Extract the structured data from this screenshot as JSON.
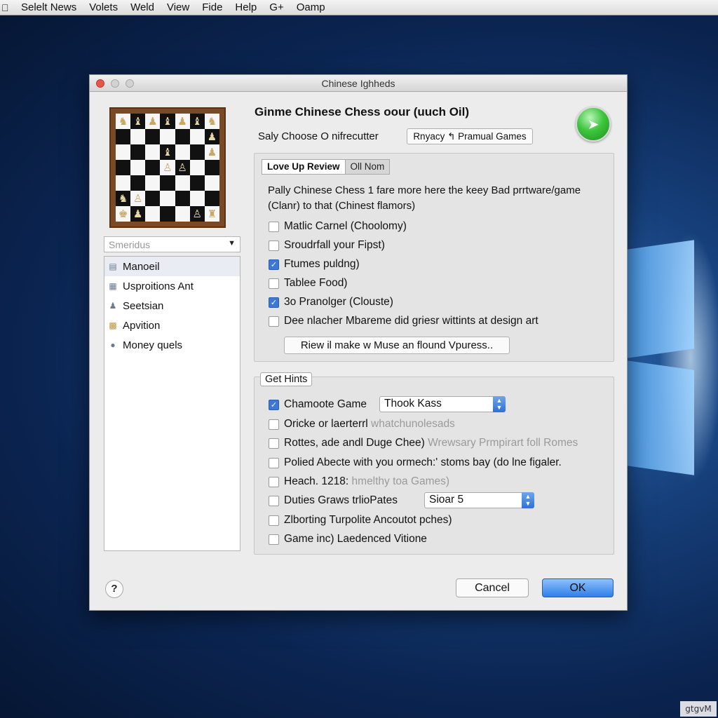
{
  "menubar": {
    "apple_icon": "apple-icon",
    "items": [
      "Selelt News",
      "Volets",
      "Weld",
      "View",
      "Fide",
      "Help",
      "G+",
      "Oamp"
    ]
  },
  "dialog": {
    "title": "Chinese Ighheds",
    "heading": "Ginme Chinese Chess oour (uuch Oil)",
    "subline": "Saly Choose O nifrecutter",
    "pill_button": "Rnyacy ↰ Pramual Games",
    "go_icon": "green-go-arrow-icon"
  },
  "left_panel": {
    "dropdown_value": "Smeridus",
    "list_items": [
      {
        "label": "Manoeil",
        "icon": "document-icon",
        "selected": true
      },
      {
        "label": "Usproitions Ant",
        "icon": "book-icon",
        "selected": false
      },
      {
        "label": "Seetsian",
        "icon": "person-icon",
        "selected": false
      },
      {
        "label": "Apvition",
        "icon": "folder-icon",
        "selected": false
      },
      {
        "label": "Money quels",
        "icon": "coin-icon",
        "selected": false
      }
    ]
  },
  "group1": {
    "tabs": [
      {
        "label": "Love Up Review",
        "active": true
      },
      {
        "label": "Oll Nom",
        "active": false
      }
    ],
    "description_line1": "Pally Chinese Chess 1 fare more here the keey Bad prrtware/game",
    "description_line2": "(Clanr) to that (Chinest flamors)",
    "checkboxes": [
      {
        "label": "Matlic Carnel (Choolomy)",
        "checked": false
      },
      {
        "label": "Sroudrfall your Fipst)",
        "checked": false
      },
      {
        "label": "Ftumes puldng)",
        "checked": true
      },
      {
        "label": "Tablee Food)",
        "checked": false
      },
      {
        "label": "3o Pranolger (Clouste)",
        "checked": true
      },
      {
        "label": "Dee nlacher Mbareme did griesr wittints at design art",
        "checked": false
      }
    ],
    "wide_button": "Riew il make w Muse an flound Vpuress.."
  },
  "group2": {
    "label": "Get Hints",
    "rows": [
      {
        "label": "Chamoote Game",
        "ghost": "",
        "checked": true,
        "popup": "Thook Kass"
      },
      {
        "label": "Oricke or laerterrl",
        "ghost": "whatchunolesads",
        "checked": false,
        "popup": ""
      },
      {
        "label": "Rottes, ade andl Duge Chee)",
        "ghost": "Wrewsary Prmpirart foll Romes",
        "checked": false,
        "popup": ""
      },
      {
        "label": "Polied Abecte with you ormech:' stoms bay (do lne figaler.",
        "ghost": "",
        "checked": false,
        "popup": ""
      },
      {
        "label": "Heach. 1218:",
        "ghost": "hmelthy toa Games)",
        "checked": false,
        "popup": ""
      },
      {
        "label": "Duties Graws trlioPates",
        "ghost": "",
        "checked": false,
        "popup": "Sioar 5"
      },
      {
        "label": "Zlborting Turpolite Ancoutot pches)",
        "ghost": "",
        "checked": false,
        "popup": ""
      },
      {
        "label": "Game inc) Laedenced Vitione",
        "ghost": "",
        "checked": false,
        "popup": ""
      }
    ]
  },
  "footer": {
    "help_label": "?",
    "cancel_label": "Cancel",
    "ok_label": "OK"
  },
  "watermark": "gtgvM",
  "colors": {
    "desktop_bg": "#0b2552",
    "accent_blue": "#3c78d8",
    "close_red": "#e8564a",
    "go_green": "#3ec63e"
  }
}
